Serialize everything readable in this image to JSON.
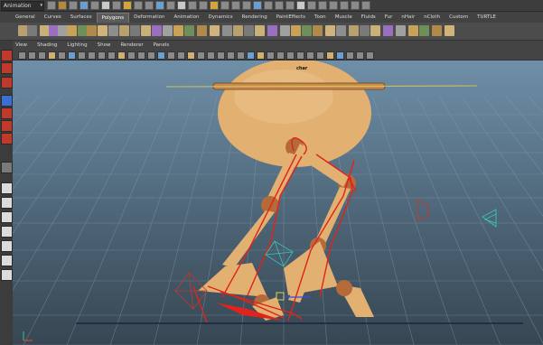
{
  "app": {
    "mode": "Animation"
  },
  "shelf": {
    "tabs": [
      "General",
      "Curves",
      "Surfaces",
      "Polygons",
      "Deformation",
      "Animation",
      "Dynamics",
      "Rendering",
      "PaintEffects",
      "Toon",
      "Muscle",
      "Fluids",
      "Fur",
      "nHair",
      "nCloth",
      "Custom",
      "TURTLE"
    ],
    "active_tab": "Polygons"
  },
  "panel_menu": {
    "items": [
      "View",
      "Shading",
      "Lighting",
      "Show",
      "Renderer",
      "Panels"
    ]
  },
  "viewport": {
    "object_label": "char"
  },
  "colors": {
    "body": "#e2b071",
    "joint": "#b56a3a",
    "annotation": "#e0231b",
    "grid": "#7f98ab",
    "locator": "#39c6b4"
  }
}
